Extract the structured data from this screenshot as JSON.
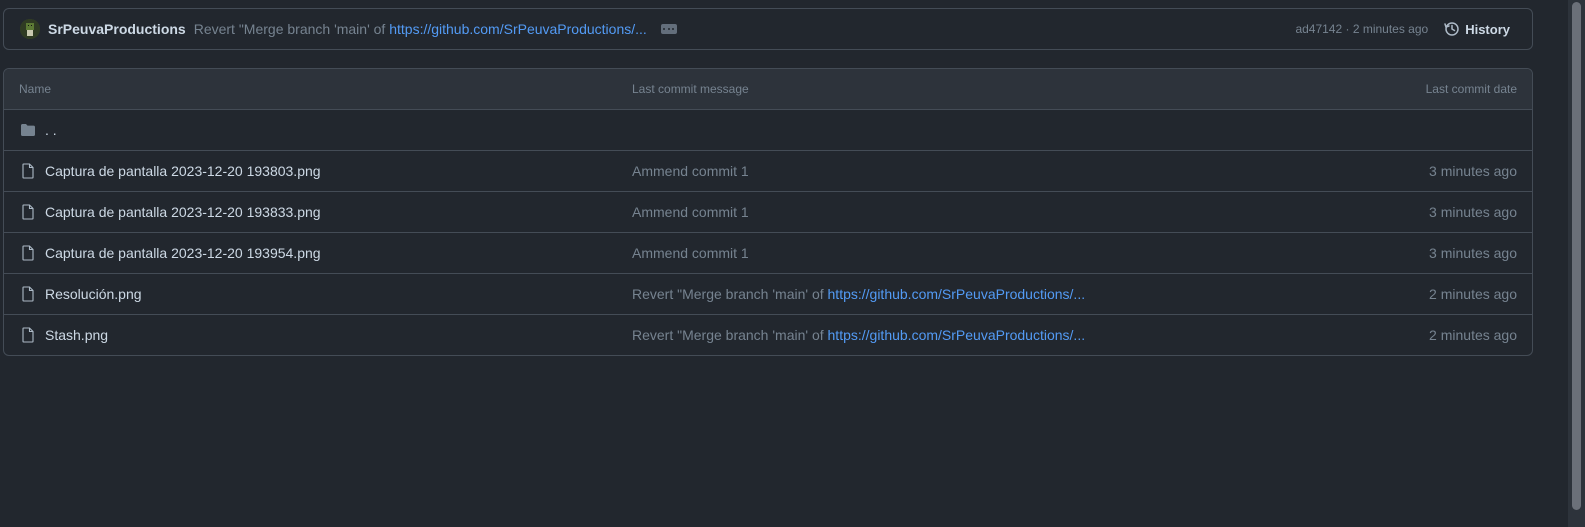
{
  "commit": {
    "author": "SrPeuvaProductions",
    "message_prefix": "Revert \"Merge branch 'main' of ",
    "message_link": "https://github.com/SrPeuvaProductions/...",
    "meta": "ad47142 · 2 minutes ago",
    "history_label": "History"
  },
  "table": {
    "headers": {
      "name": "Name",
      "message": "Last commit message",
      "date": "Last commit date"
    },
    "parent_label": ". .",
    "rows": [
      {
        "name": "Captura de pantalla 2023-12-20 193803.png",
        "message": "Ammend commit 1",
        "message_link": "",
        "date": "3 minutes ago"
      },
      {
        "name": "Captura de pantalla 2023-12-20 193833.png",
        "message": "Ammend commit 1",
        "message_link": "",
        "date": "3 minutes ago"
      },
      {
        "name": "Captura de pantalla 2023-12-20 193954.png",
        "message": "Ammend commit 1",
        "message_link": "",
        "date": "3 minutes ago"
      },
      {
        "name": "Resolución.png",
        "message": "Revert \"Merge branch 'main' of ",
        "message_link": "https://github.com/SrPeuvaProductions/...",
        "date": "2 minutes ago"
      },
      {
        "name": "Stash.png",
        "message": "Revert \"Merge branch 'main' of ",
        "message_link": "https://github.com/SrPeuvaProductions/...",
        "date": "2 minutes ago"
      }
    ]
  },
  "colors": {
    "background": "#22272e",
    "header_background": "#2d333b",
    "border": "#444c56",
    "link": "#539bf5",
    "muted_text": "#768390",
    "primary_text": "#cdd9e5"
  },
  "icons": {
    "folder": "folder-icon",
    "file": "file-icon",
    "history": "history-icon",
    "ellipsis": "ellipsis-icon"
  }
}
